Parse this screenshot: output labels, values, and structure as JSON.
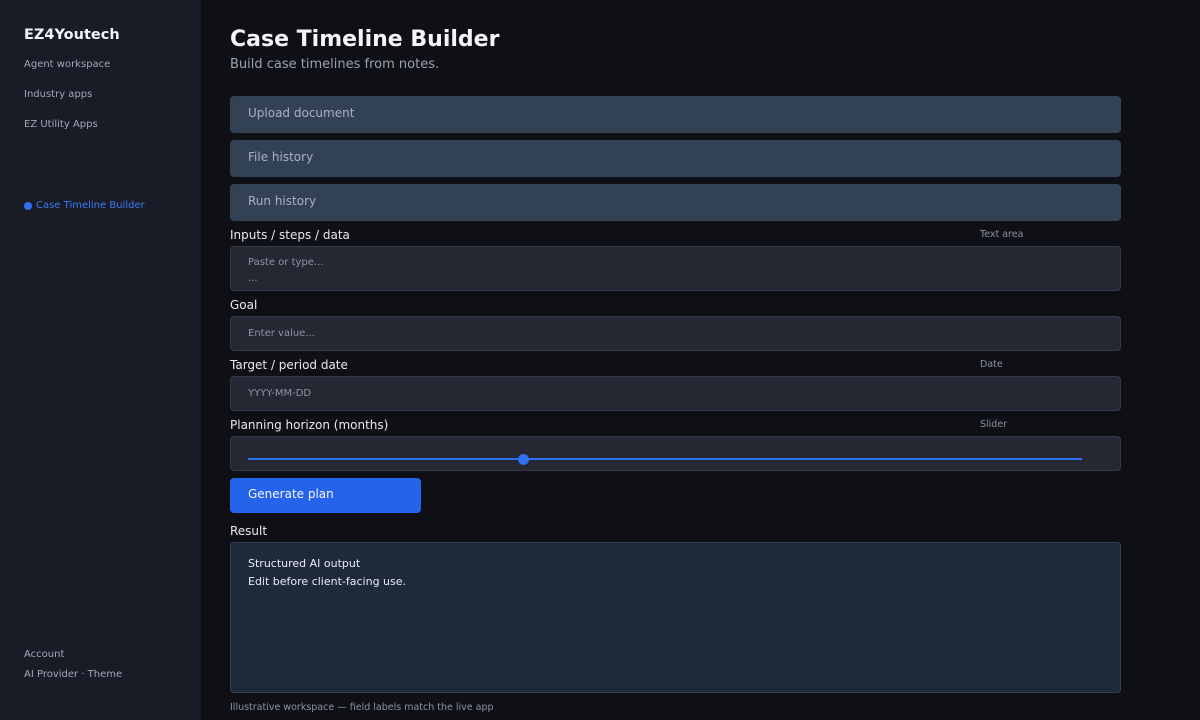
{
  "sidebar": {
    "brand": "EZ4Youtech",
    "nav": [
      "Agent workspace",
      "Industry apps",
      "EZ Utility Apps"
    ],
    "active_app": "Case Timeline Builder",
    "footer": [
      "Account",
      "AI Provider · Theme"
    ]
  },
  "main": {
    "title": "Case Timeline Builder",
    "subtitle": "Build case timelines from notes.",
    "bars": [
      "Upload document",
      "File history",
      "Run history"
    ],
    "inputs": {
      "label": "Inputs / steps / data",
      "hint": "Text area",
      "placeholder": "Paste or type...\n..."
    },
    "goal": {
      "label": "Goal",
      "placeholder": "Enter value..."
    },
    "target_date": {
      "label": "Target / period date",
      "hint": "Date",
      "placeholder": "YYYY-MM-DD"
    },
    "horizon": {
      "label": "Planning horizon (months)",
      "hint": "Slider",
      "value_fraction": 0.33
    },
    "generate_label": "Generate plan",
    "result": {
      "label": "Result",
      "line1": "Structured AI output",
      "line2": "Edit before client-facing use."
    },
    "footnote": "Illustrative workspace — field labels match the live app"
  },
  "colors": {
    "accent": "#2563eb",
    "sidebar_bg": "#191b26",
    "page_bg": "#0e1016"
  }
}
